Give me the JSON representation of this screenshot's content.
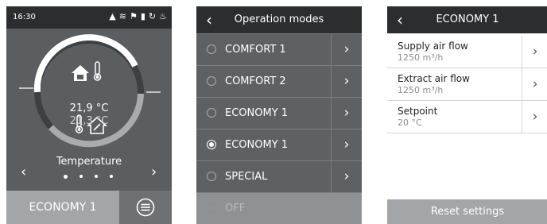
{
  "screen_home": {
    "time": "16:30",
    "status_icons": [
      "warning-icon",
      "heat-exchanger-icon",
      "fan-off-icon",
      "filter-icon",
      "refresh-icon",
      "heater-icon"
    ],
    "outdoor_temp": "21,9 °C",
    "indoor_temp": "21,3 °C",
    "carousel_label": "Temperature",
    "page_dots": 4,
    "current_mode": "ECONOMY 1",
    "colors": {
      "ring_active": "#ffffff",
      "ring_track": "#a9acaf",
      "background": "#5b5e61"
    }
  },
  "screen_modes": {
    "title": "Operation modes",
    "items": [
      {
        "label": "COMFORT 1",
        "selected": false
      },
      {
        "label": "COMFORT 2",
        "selected": false
      },
      {
        "label": "ECONOMY 1",
        "selected": false
      },
      {
        "label": "ECONOMY 1",
        "selected": true
      },
      {
        "label": "SPECIAL",
        "selected": false
      },
      {
        "label": "OFF",
        "selected": false
      }
    ]
  },
  "screen_economy": {
    "title": "ECONOMY 1",
    "params": [
      {
        "name": "Supply air flow",
        "value": "1250 m³/h"
      },
      {
        "name": "Extract air flow",
        "value": "1250 m³/h"
      },
      {
        "name": "Setpoint",
        "value": "20 °C"
      }
    ],
    "reset_label": "Reset settings"
  }
}
